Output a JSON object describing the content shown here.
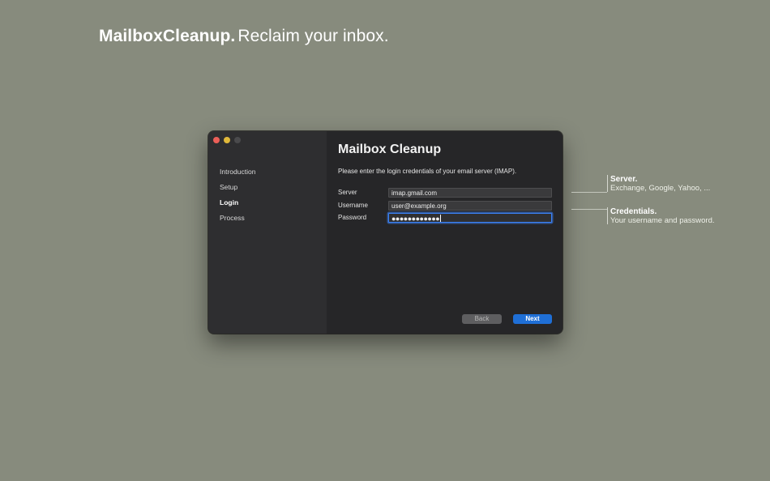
{
  "headline": {
    "brand": "MailboxCleanup.",
    "tagline": "Reclaim your inbox."
  },
  "window": {
    "title": "Mailbox Cleanup",
    "description": "Please enter the login credentials of your email server (IMAP).",
    "steps": [
      {
        "label": "Introduction",
        "active": false
      },
      {
        "label": "Setup",
        "active": false
      },
      {
        "label": "Login",
        "active": true
      },
      {
        "label": "Process",
        "active": false
      }
    ],
    "form": {
      "server": {
        "label": "Server",
        "value": "imap.gmail.com"
      },
      "username": {
        "label": "Username",
        "value": "user@example.org"
      },
      "password": {
        "label": "Password",
        "value": "●●●●●●●●●●●●"
      }
    },
    "buttons": {
      "back": "Back",
      "next": "Next"
    }
  },
  "callouts": [
    {
      "title": "Server.",
      "detail": "Exchange, Google, Yahoo, ..."
    },
    {
      "title": "Credentials.",
      "detail": "Your username and password."
    }
  ],
  "colors": {
    "background": "#878b7d",
    "accent": "#1f6fd6",
    "focus_ring": "#3b82f6"
  }
}
